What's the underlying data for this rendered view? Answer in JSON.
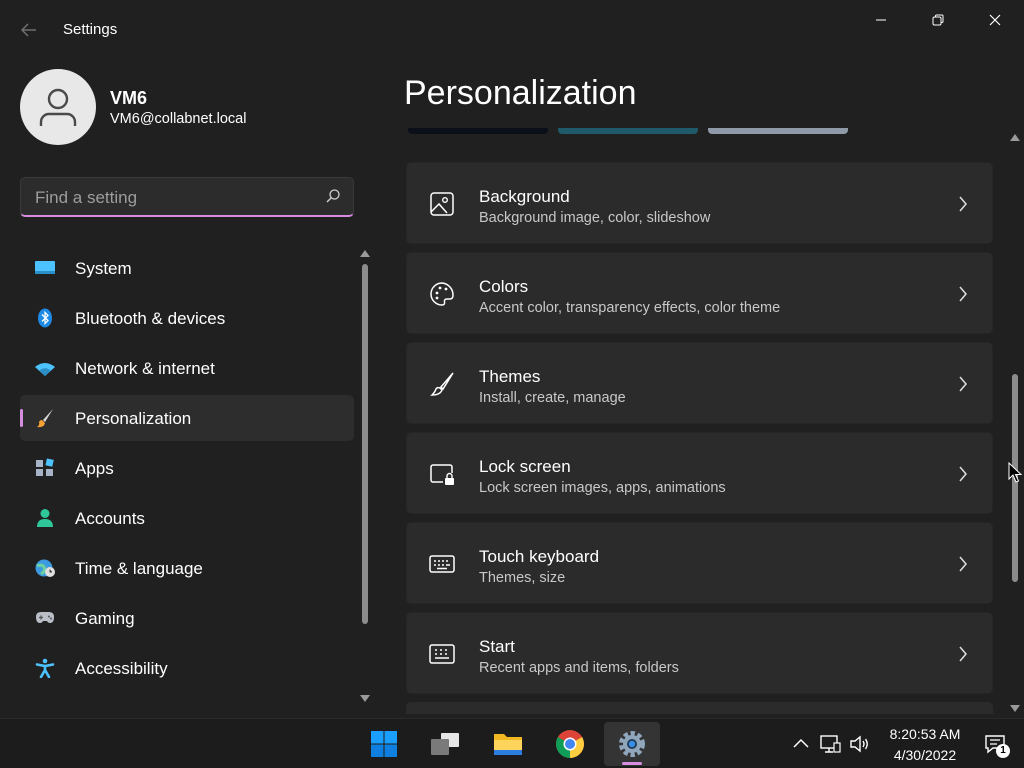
{
  "window": {
    "title": "Settings",
    "minimize_icon": "minimize-icon",
    "maximize_icon": "restore-icon",
    "close_icon": "close-icon"
  },
  "profile": {
    "name": "VM6",
    "email": "VM6@collabnet.local"
  },
  "search": {
    "placeholder": "Find a setting"
  },
  "sidebar": {
    "items": [
      {
        "label": "System",
        "icon": "system-icon",
        "active": false
      },
      {
        "label": "Bluetooth & devices",
        "icon": "bluetooth-icon",
        "active": false
      },
      {
        "label": "Network & internet",
        "icon": "wifi-icon",
        "active": false
      },
      {
        "label": "Personalization",
        "icon": "brush-icon",
        "active": true
      },
      {
        "label": "Apps",
        "icon": "apps-icon",
        "active": false
      },
      {
        "label": "Accounts",
        "icon": "person-icon",
        "active": false
      },
      {
        "label": "Time & language",
        "icon": "globe-clock-icon",
        "active": false
      },
      {
        "label": "Gaming",
        "icon": "gamepad-icon",
        "active": false
      },
      {
        "label": "Accessibility",
        "icon": "accessibility-icon",
        "active": false
      }
    ]
  },
  "main": {
    "title": "Personalization",
    "cards": [
      {
        "title": "Background",
        "subtitle": "Background image, color, slideshow",
        "icon": "image-icon"
      },
      {
        "title": "Colors",
        "subtitle": "Accent color, transparency effects, color theme",
        "icon": "palette-icon"
      },
      {
        "title": "Themes",
        "subtitle": "Install, create, manage",
        "icon": "brush-icon"
      },
      {
        "title": "Lock screen",
        "subtitle": "Lock screen images, apps, animations",
        "icon": "lock-screen-icon"
      },
      {
        "title": "Touch keyboard",
        "subtitle": "Themes, size",
        "icon": "keyboard-icon"
      },
      {
        "title": "Start",
        "subtitle": "Recent apps and items, folders",
        "icon": "start-icon"
      }
    ]
  },
  "taskbar": {
    "apps": [
      {
        "name": "Start",
        "icon": "windows-icon",
        "active": false
      },
      {
        "name": "Task View",
        "icon": "task-view-icon",
        "active": false
      },
      {
        "name": "File Explorer",
        "icon": "folder-icon",
        "active": false
      },
      {
        "name": "Google Chrome",
        "icon": "chrome-icon",
        "active": false
      },
      {
        "name": "Settings",
        "icon": "gear-icon",
        "active": true
      }
    ],
    "tray": {
      "time": "8:20:53 AM",
      "date": "4/30/2022",
      "notification_count": "1"
    }
  },
  "colors": {
    "accent": "#d68de0",
    "background": "#202020",
    "card": "#2b2b2b"
  }
}
